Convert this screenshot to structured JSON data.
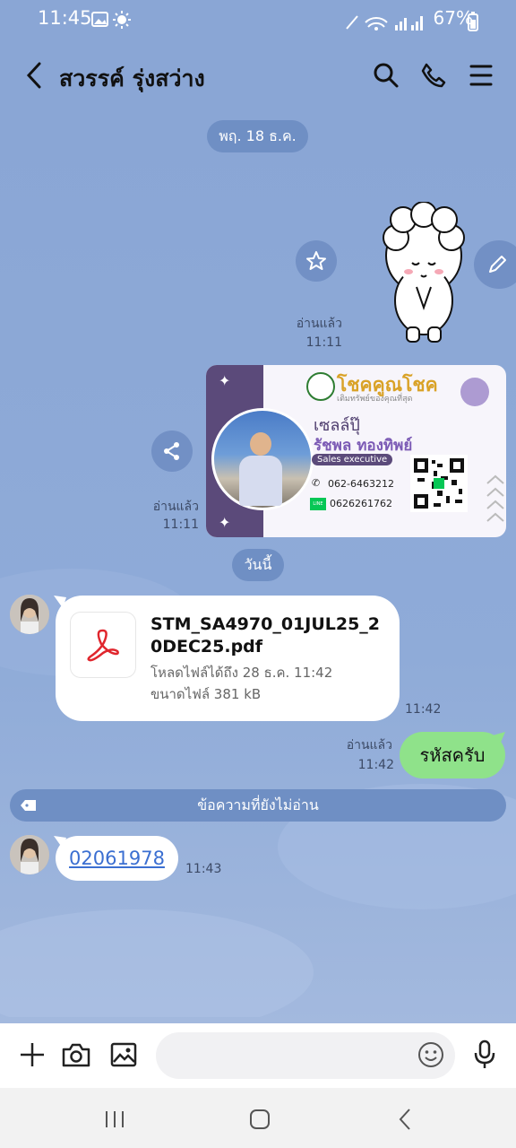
{
  "status": {
    "time": "11:45",
    "battery": "67%"
  },
  "header": {
    "contact_name": "สวรรค์  รุ่งสว่าง"
  },
  "chat": {
    "date_separator_1": "พฤ. 18 ธ.ค.",
    "sticker_read": "อ่านแล้ว",
    "sticker_time": "11:11",
    "card_read": "อ่านแล้ว",
    "card_time": "11:11",
    "card": {
      "brand": "โชคคูณโชค",
      "tagline": "เติมทรัพย์ของคุณที่สุด",
      "nickname": "เซลล์ปุ๊",
      "name": "รัชพล  ทองทิพย์",
      "role": "Sales executive",
      "phone": "062-6463212",
      "line_label": "LINE",
      "line_id": "0626261762"
    },
    "date_separator_2": "วันนี้",
    "file": {
      "name": "STM_SA4970_01JUL25_20DEC25.pdf",
      "download_until": "โหลดไฟล์ได้ถึง 28 ธ.ค. 11:42",
      "size": "ขนาดไฟล์ 381 kB",
      "time": "11:42"
    },
    "sent_msg": {
      "text": "รหัสครับ",
      "read": "อ่านแล้ว",
      "time": "11:42"
    },
    "unread_label": "ข้อความที่ยังไม่อ่าน",
    "link_msg": {
      "text": "02061978",
      "time": "11:43"
    }
  },
  "colors": {
    "sent_bubble": "#8fe28a",
    "chat_bg": "#8fa9d6",
    "link": "#3b6fd1"
  }
}
